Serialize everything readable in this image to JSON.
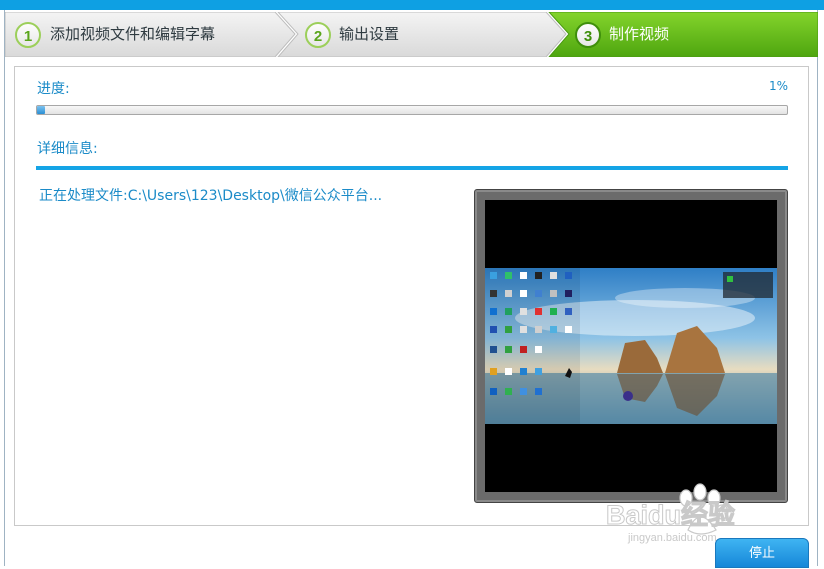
{
  "steps": [
    {
      "number": "1",
      "label": "添加视频文件和编辑字幕",
      "active": false
    },
    {
      "number": "2",
      "label": "输出设置",
      "active": false
    },
    {
      "number": "3",
      "label": "制作视频",
      "active": true
    }
  ],
  "progress": {
    "label": "进度:",
    "percent_text": "1%",
    "value_percent": 1
  },
  "details": {
    "label": "详细信息:",
    "processing_text": "正在处理文件:C:\\Users\\123\\Desktop\\微信公众平台..."
  },
  "preview": {
    "icon": "desktop-screenshot-thumbnail"
  },
  "watermark": {
    "brand": "Baidu经验",
    "url": "jingyan.baidu.com"
  },
  "buttons": {
    "stop_label": "停止"
  },
  "colors": {
    "accent_blue": "#15a4e6",
    "text_blue": "#1b8bc8",
    "active_step_green": "#6fbf1f"
  }
}
